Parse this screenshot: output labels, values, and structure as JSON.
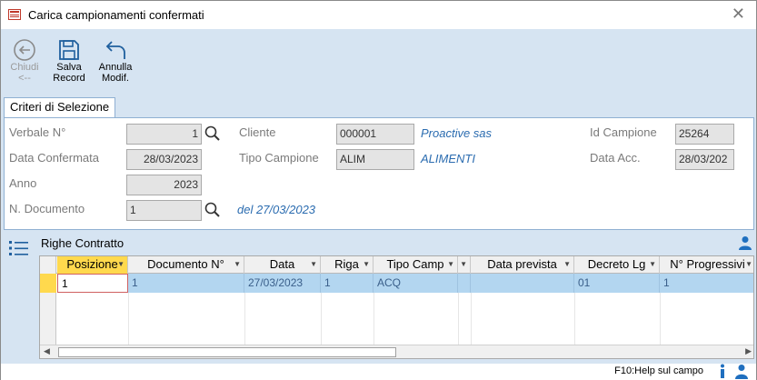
{
  "window": {
    "title": "Carica campionamenti confermati"
  },
  "toolbar": {
    "close_label": "Chiudi\n<--",
    "save_label": "Salva\nRecord",
    "undo_label": "Annulla\nModif."
  },
  "tab": {
    "label": "Criteri di Selezione"
  },
  "criteria": {
    "verbale_label": "Verbale N°",
    "verbale_value": "1",
    "data_confermata_label": "Data Confermata",
    "data_confermata_value": "28/03/2023",
    "anno_label": "Anno",
    "anno_value": "2023",
    "n_documento_label": "N. Documento",
    "n_documento_value": "1",
    "documento_date": "del 27/03/2023",
    "cliente_label": "Cliente",
    "cliente_code": "000001",
    "cliente_name": "Proactive sas",
    "tipo_campione_label": "Tipo Campione",
    "tipo_campione_code": "ALIM",
    "tipo_campione_name": "ALIMENTI",
    "id_campione_label": "Id Campione",
    "id_campione_value": "25264",
    "data_acc_label": "Data Acc.",
    "data_acc_value": "28/03/202"
  },
  "grid": {
    "title": "Righe Contratto",
    "columns": [
      "Posizione",
      "Documento N°",
      "Data",
      "Riga",
      "Tipo Camp",
      "",
      "Data prevista",
      "Decreto Lg",
      "N° Progressivi"
    ],
    "rows": [
      [
        "1",
        "1",
        "27/03/2023",
        "1",
        "ACQ",
        "",
        "",
        "01",
        "1"
      ]
    ]
  },
  "status": {
    "help_text": "F10:Help sul campo"
  },
  "colors": {
    "panel_bg": "#d6e4f2",
    "accent_blue": "#2b6cb0",
    "active_header": "#ffd94d"
  }
}
